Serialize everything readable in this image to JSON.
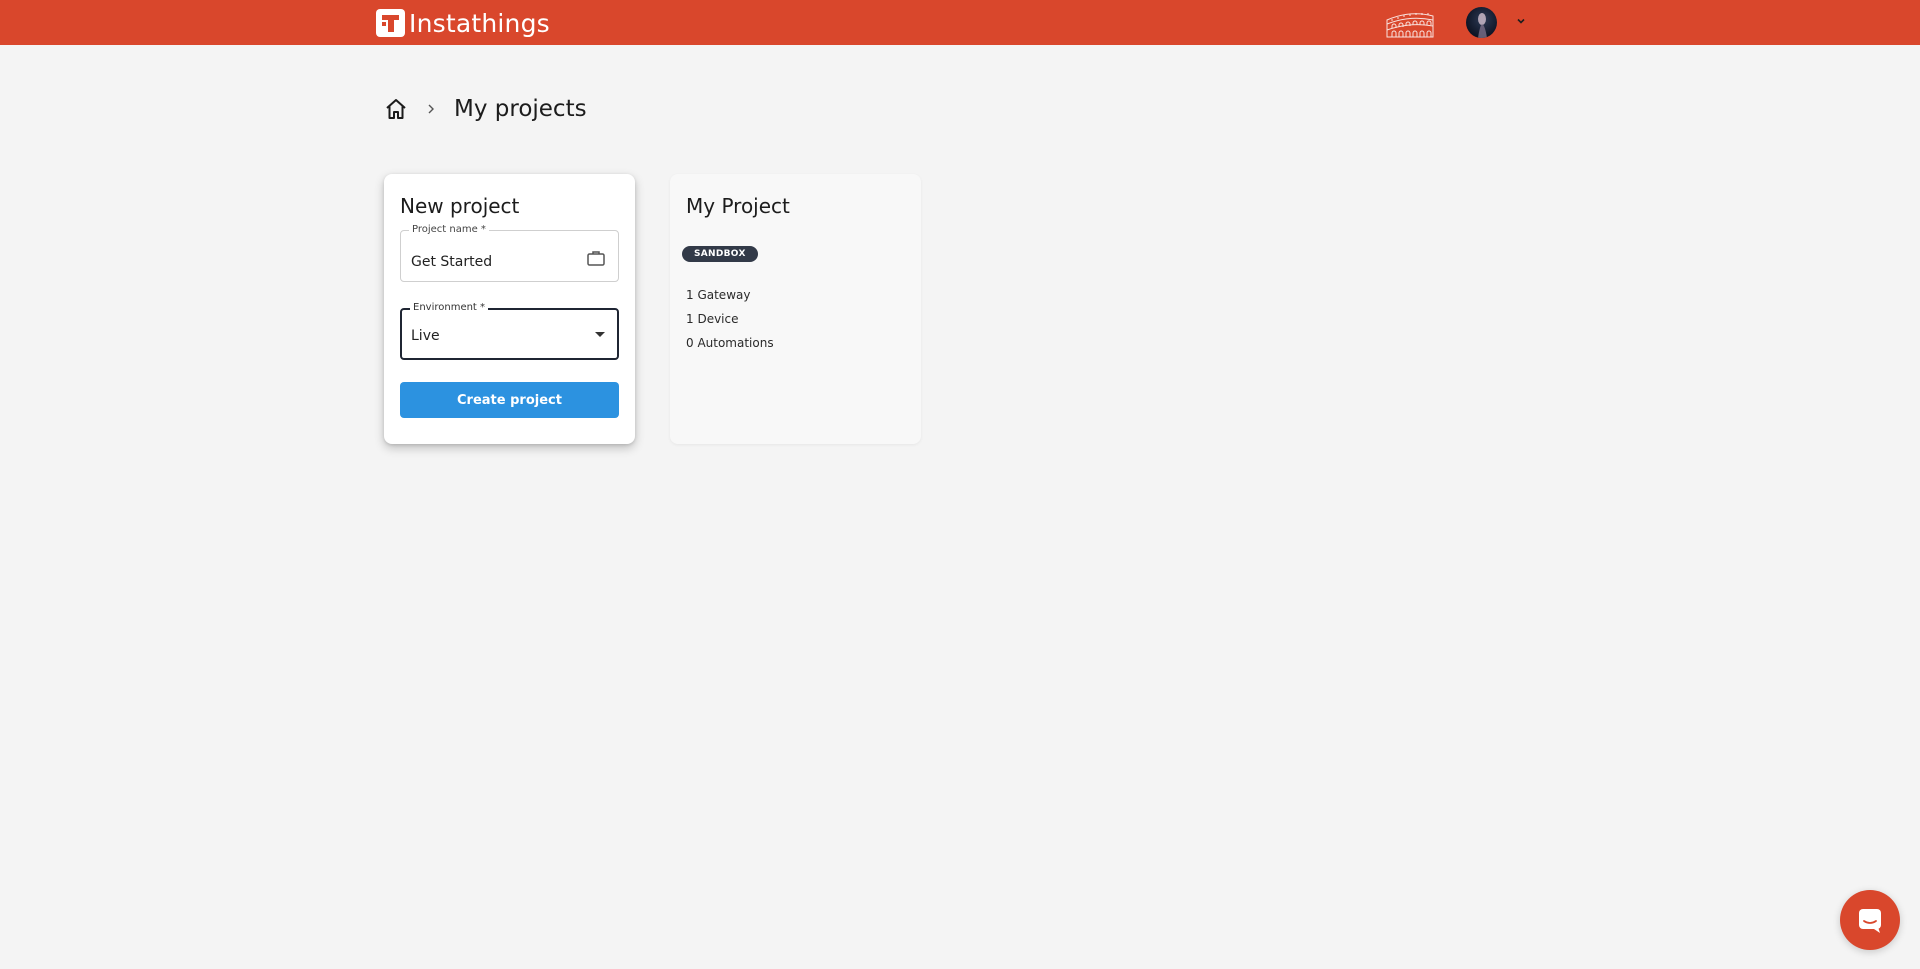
{
  "header": {
    "brand_name": "Instathings",
    "brand_color": "#d9472c",
    "brand_logo_icon": "instathings-t-logo",
    "region_icon": "colosseum-icon",
    "user_avatar": "avatar",
    "user_menu_icon": "chevron-down-icon"
  },
  "breadcrumb": {
    "home_icon": "home-icon",
    "separator_icon": "chevron-right-icon",
    "current": "My projects"
  },
  "new_project": {
    "title": "New project",
    "project_name_label": "Project name *",
    "project_name_value": "Get Started",
    "project_name_icon": "briefcase-icon",
    "environment_label": "Environment *",
    "environment_value": "Live",
    "create_button": "Create project",
    "button_color": "#2c92e0"
  },
  "projects": [
    {
      "title": "My Project",
      "badge": "SANDBOX",
      "stats": [
        "1 Gateway",
        "1 Device",
        "0 Automations"
      ]
    }
  ],
  "chat": {
    "icon": "chat-icon"
  }
}
